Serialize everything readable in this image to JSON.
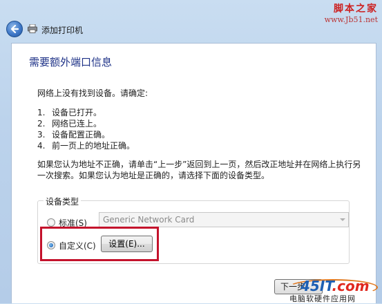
{
  "watermark": {
    "top_line1": "脚本之家",
    "top_line2": "www.Jb51.net",
    "bottom_logo": "45IT",
    "bottom_logo_suffix": ".com",
    "bottom_sub": "电脑软硬件应用网"
  },
  "window": {
    "title": "添加打印机",
    "back_icon": "back-arrow-icon",
    "printer_icon": "printer-icon"
  },
  "page": {
    "heading": "需要额外端口信息",
    "intro": "网络上没有找到设备。请确定:",
    "steps": [
      {
        "num": "1.",
        "text": "设备已打开。"
      },
      {
        "num": "2.",
        "text": "网络已连上。"
      },
      {
        "num": "3.",
        "text": "设备配置正确。"
      },
      {
        "num": "4.",
        "text": "前一页上的地址正确。"
      }
    ],
    "advice": "如果您认为地址不正确，请单击“上一步”返回到上一页，然后改正地址并在网络上执行另一次搜索。如果您认为地址是正确的，请选择下面的设备类型。"
  },
  "device_type": {
    "legend": "设备类型",
    "standard_label": "标准(S)",
    "standard_checked": false,
    "standard_value": "Generic Network Card",
    "custom_label": "自定义(C)",
    "custom_checked": true,
    "settings_button": "设置(E)..."
  },
  "footer": {
    "next_button": "下一步"
  },
  "colors": {
    "heading": "#1e3287",
    "highlight": "#c4122c",
    "background": "#bcd3ec"
  }
}
